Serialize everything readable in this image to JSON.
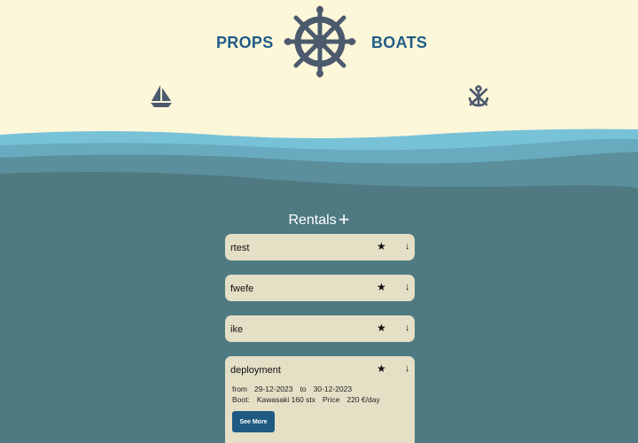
{
  "header": {
    "brand_left": "PROPS",
    "brand_right": "BOATS",
    "icons": [
      "ship-wheel-icon",
      "sailboat-icon",
      "anchor-icon"
    ]
  },
  "rentals": {
    "title": "Rentals",
    "add_label": "+",
    "items": [
      {
        "name": "rtest",
        "star": "★",
        "toggle": "↓"
      },
      {
        "name": "fwefe",
        "star": "★",
        "toggle": "↓"
      },
      {
        "name": "ike",
        "star": "★",
        "toggle": "↓"
      },
      {
        "name": "deployment",
        "star": "★",
        "toggle": "↓",
        "from_label": "from",
        "from": "29-12-2023",
        "to_label": "to",
        "to": "30-12-2023",
        "boat_label": "Boot:",
        "boat": "Kawasaki 160 stx",
        "price_label": "Price",
        "price": "220 €/day",
        "button": "See More"
      }
    ]
  },
  "colors": {
    "sand": "#fdf7da",
    "sea": "#4f7a82",
    "brand": "#1f5c86",
    "card": "#e4dfc5",
    "button": "#1e5a82"
  }
}
